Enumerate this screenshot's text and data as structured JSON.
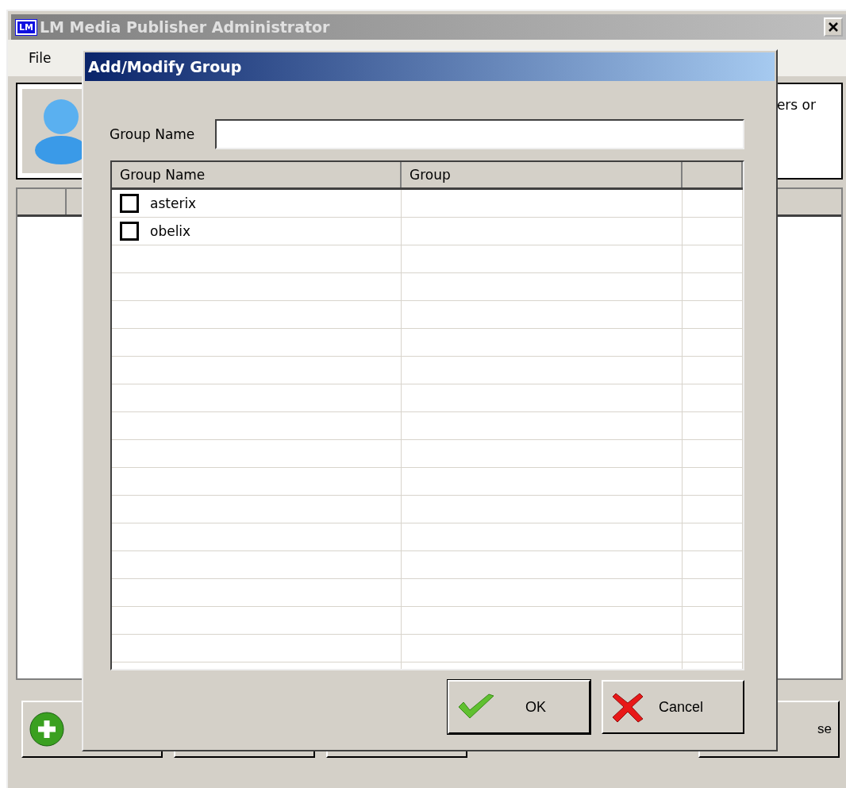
{
  "window": {
    "title": "LM Media Publisher Administrator",
    "logo": "LM"
  },
  "menu": [
    "File"
  ],
  "info_panel": {
    "text": "ers or"
  },
  "bottom_buttons": [
    {
      "kind": "add"
    },
    {
      "kind": "plain"
    },
    {
      "kind": "plain"
    },
    {
      "kind": "close",
      "label": "se"
    }
  ],
  "dialog": {
    "title": "Add/Modify Group",
    "field": {
      "label": "Group Name"
    },
    "table": {
      "columns": [
        "Group Name",
        "Group"
      ],
      "rows": [
        {
          "name": "asterix",
          "checked": false
        },
        {
          "name": "obelix",
          "checked": false
        }
      ]
    },
    "buttons": [
      {
        "kind": "ok",
        "label": "OK"
      },
      {
        "kind": "cancel",
        "label": "Cancel"
      }
    ]
  }
}
